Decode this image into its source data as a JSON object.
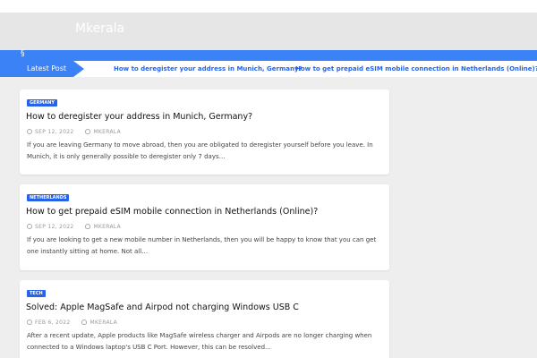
{
  "site": {
    "title": "Mkerala"
  },
  "nav": {
    "home_glyph": "§"
  },
  "ticker": {
    "label": "Latest Post",
    "links": [
      "How to deregister your address in Munich, Germany?",
      "How to get prepaid eSIM mobile connection in Netherlands (Online)?"
    ]
  },
  "posts": [
    {
      "category": "GERMANY",
      "title": "How to deregister your address in Munich, Germany?",
      "date": "SEP 12, 2022",
      "author": "MKERALA",
      "excerpt": "If you are leaving Germany to move abroad, then you are obligated to deregister yourself before you leave. In Munich, it is only generally possible to deregister only 7 days…"
    },
    {
      "category": "NETHERLANDS",
      "title": "How to get prepaid eSIM mobile connection in Netherlands (Online)?",
      "date": "SEP 12, 2022",
      "author": "MKERALA",
      "excerpt": "If you are looking to get a new mobile number in Netherlands, then you will be happy to know that you can get one instantly sitting at home. Not all…"
    },
    {
      "category": "TECH",
      "title": "Solved: Apple MagSafe and Airpod not charging Windows USB C",
      "date": "FEB 6, 2022",
      "author": "MKERALA",
      "excerpt": "After a recent update, Apple products like MagSafe wireless charger and Airpods are no longer charging when connected to a Windows laptop's USB C Port. However, this can be resolved…"
    }
  ],
  "colors": {
    "accent": "#3b82f6",
    "link": "#2563eb",
    "background": "#eeeeee"
  },
  "icons": {
    "date": "clock-icon",
    "author": "user-icon"
  }
}
